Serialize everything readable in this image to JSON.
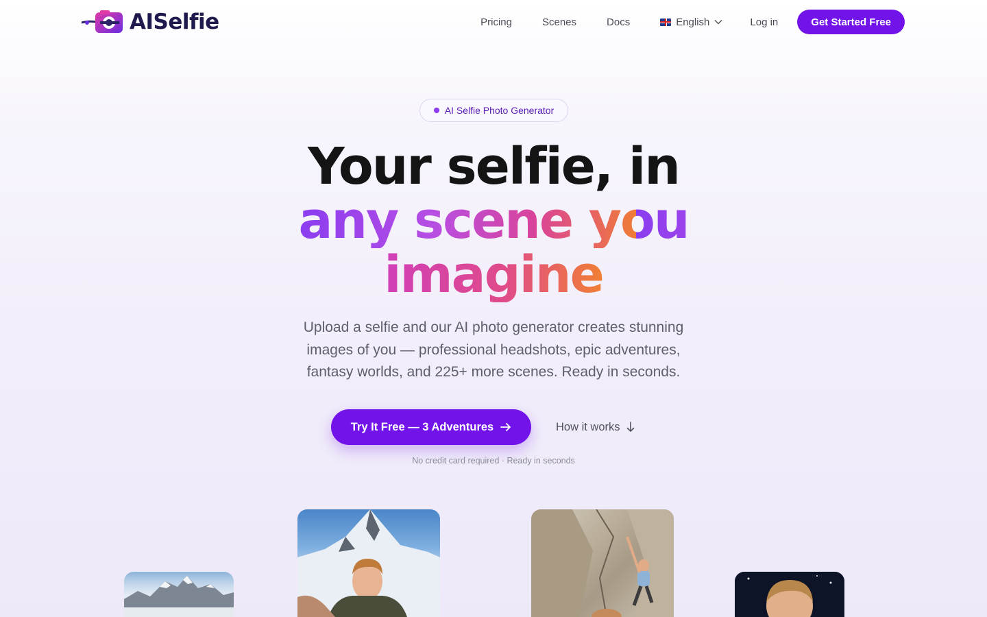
{
  "nav": {
    "brand": "AISelfie",
    "links": [
      "Pricing",
      "Scenes",
      "Docs"
    ],
    "language": "English",
    "login": "Log in",
    "cta": "Get Started Free"
  },
  "hero": {
    "badge": "AI Selfie Photo Generator",
    "title_line1": "Your selfie, in",
    "title_line2": "any scene you",
    "title_line3": "imagine",
    "subtitle": "Upload a selfie and our AI photo generator creates stunning images of you — professional headshots, epic adventures, fantasy worlds, and 225+ more scenes. Ready in seconds.",
    "primary_cta": "Try It Free — 3 Adventures",
    "secondary_cta": "How it works",
    "note": "No credit card required · Ready in seconds"
  },
  "gallery": {
    "photos": [
      "mountain-landscape",
      "mountain-summit-selfie",
      "rock-climbing-selfie",
      "night-scene-selfie"
    ]
  },
  "colors": {
    "accent": "#7213ea",
    "gradient": [
      "#8a3df0",
      "#b74ee3",
      "#d9449a",
      "#f07c36"
    ]
  }
}
